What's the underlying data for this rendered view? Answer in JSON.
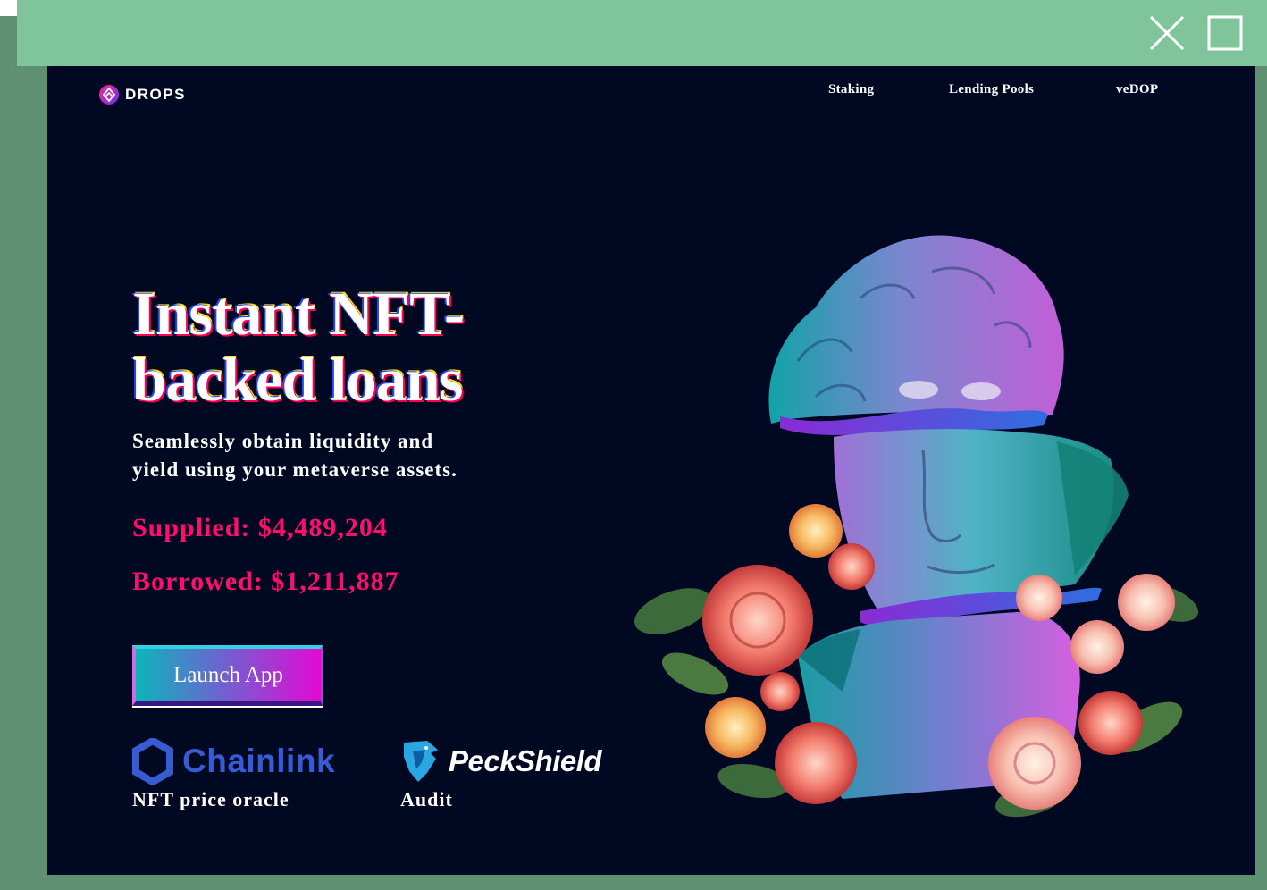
{
  "window": {
    "close_icon": "close-icon",
    "maximize_icon": "maximize-icon"
  },
  "header": {
    "logo_text": "DROPS",
    "nav": [
      {
        "label": "Staking"
      },
      {
        "label": "Lending Pools"
      },
      {
        "label": "veDOP"
      }
    ]
  },
  "hero": {
    "headline_line1": "Instant NFT-",
    "headline_line2": "backed loans",
    "subtitle_line1": "Seamlessly obtain liquidity and",
    "subtitle_line2": "yield using your metaverse assets.",
    "supplied": "Supplied: $4,489,204",
    "borrowed": "Borrowed: $1,211,887",
    "cta_label": "Launch App"
  },
  "partners": [
    {
      "name": "Chainlink",
      "caption": "NFT price oracle"
    },
    {
      "name": "PeckShield",
      "caption": "Audit"
    }
  ],
  "colors": {
    "window_bar": "#80c49c",
    "page_bg": "#000822",
    "accent_pink": "#ff0e6e",
    "chainlink_blue": "#375bd2"
  }
}
